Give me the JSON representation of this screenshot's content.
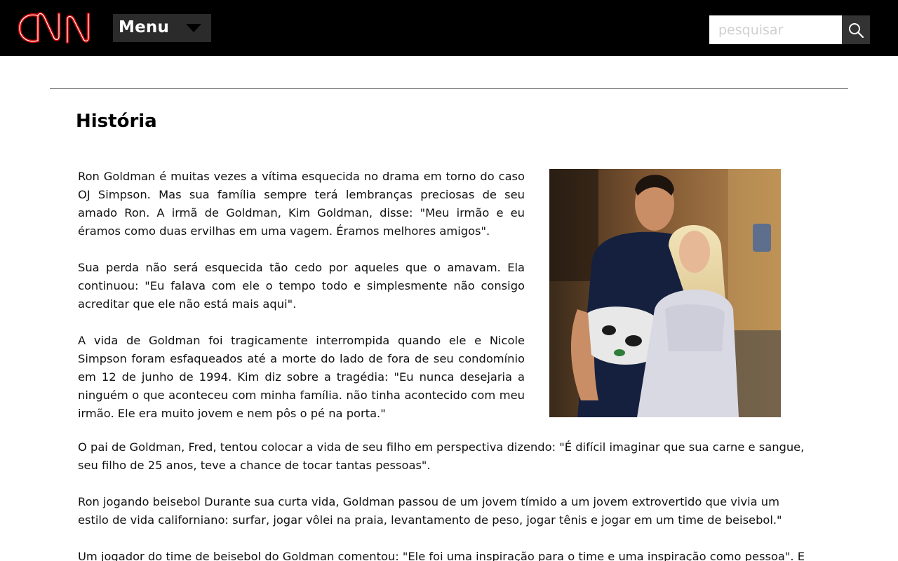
{
  "header": {
    "logo_text": "CNN",
    "menu_label": "Menu",
    "search_placeholder": "pesquisar",
    "colors": {
      "bar": "#000000",
      "logo": "#cc0000",
      "menu_bg": "#2b2b2b",
      "search_btn": "#333333"
    }
  },
  "article": {
    "title": "História",
    "paragraphs": [
      "Ron Goldman é muitas vezes a vítima esquecida no drama em torno do caso OJ Simpson. Mas sua família sempre terá lembranças preciosas de seu amado Ron. A irmã de Goldman, Kim Goldman, disse: \"Meu irmão e eu éramos como duas ervilhas em uma vagem. Éramos melhores amigos\".",
      "Sua perda não será esquecida tão cedo por aqueles que o amavam. Ela continuou: \"Eu falava com ele o tempo todo e simplesmente não consigo acreditar que ele não está mais aqui\".",
      "A vida de Goldman foi tragicamente interrompida quando ele e Nicole Simpson foram esfaqueados até a morte do lado de fora de seu condomínio em 12 de junho de 1994. Kim diz sobre a tragédia: \"Eu nunca desejaria a ninguém o que aconteceu com minha família. não tinha acontecido com meu irmão. Ele era muito jovem e nem pôs o pé na porta.\"",
      "O pai de Goldman, Fred, tentou colocar a vida de seu filho em perspectiva dizendo: \"É difícil imaginar que sua carne e sangue, seu filho de 25 anos, teve a chance de tocar tantas pessoas\".",
      "Ron jogando beisebol Durante sua curta vida, Goldman passou de um jovem tímido a um jovem extrovertido que vivia um estilo de vida californiano: surfar, jogar vôlei na praia, levantamento de peso, jogar tênis e jogar em um time de beisebol.\"",
      "Um jogador do time de beisebol do Goldman comentou: \"Ele foi uma inspiração para o time e uma inspiração como pessoa\". E"
    ]
  },
  "icons": {
    "search": "search-icon",
    "menu_arrow": "caret-down-icon"
  }
}
